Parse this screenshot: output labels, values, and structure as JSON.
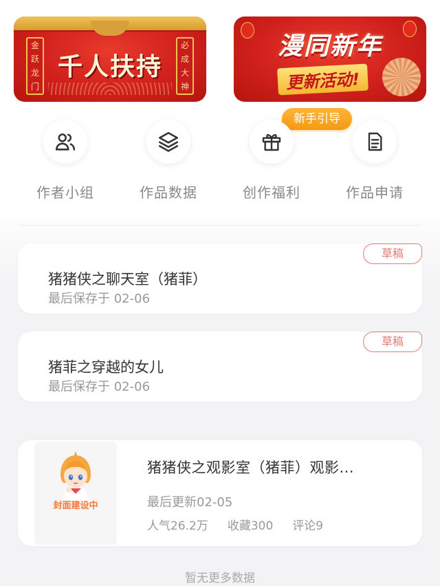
{
  "banners": {
    "left": {
      "title": "千人扶持",
      "couplet_left": [
        "金",
        "跃",
        "龙",
        "门"
      ],
      "couplet_right": [
        "必",
        "成",
        "大",
        "神"
      ]
    },
    "right": {
      "title_line1": "漫同新年",
      "title_line2": "更新活动!"
    }
  },
  "guide_badge": "新手引导",
  "quick_actions": [
    {
      "label": "作者小组",
      "icon": "users-icon"
    },
    {
      "label": "作品数据",
      "icon": "layers-icon"
    },
    {
      "label": "创作福利",
      "icon": "gift-icon"
    },
    {
      "label": "作品申请",
      "icon": "document-icon"
    }
  ],
  "drafts": [
    {
      "title": "猪猪侠之聊天室（猪菲）",
      "saved": "最后保存于 02-06",
      "badge": "草稿"
    },
    {
      "title": "猪菲之穿越的女儿",
      "saved": "最后保存于 02-06",
      "badge": "草稿"
    }
  ],
  "work": {
    "cover_text": "封面建设中",
    "title": "猪猪侠之观影室（猪菲）观影...",
    "updated": "最后更新02-05",
    "popularity": "人气26.2万",
    "favorites": "收藏300",
    "comments": "评论9"
  },
  "footer": {
    "no_more": "暂无更多数据"
  },
  "colors": {
    "accent": "#e27b73",
    "badge_orange": "#f59a10",
    "banner_red": "#d0201c"
  }
}
